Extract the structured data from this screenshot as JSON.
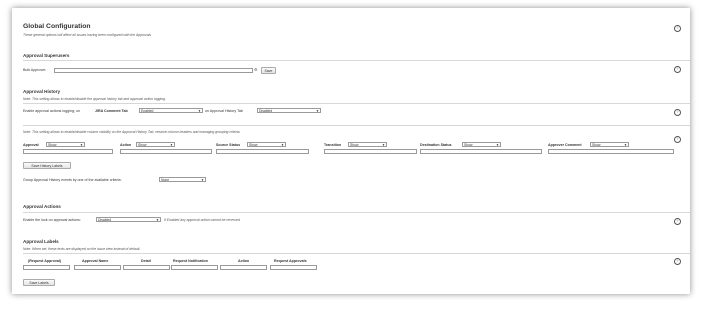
{
  "header": {
    "title": "Global Configuration",
    "subtitle": "These general options will affect all issues having been configured with the Approvals"
  },
  "superusers": {
    "heading": "Approval Superusers",
    "bulk_label": "Bulk Approver:",
    "bulk_value": "",
    "save_label": "Save"
  },
  "history": {
    "heading": "Approval History",
    "note": "Note: This setting allows to enable/disable the approval history tab and approval action logging.",
    "enable_label": "Enable approval actions logging; on",
    "jira_tab_label": "JIRA Comment Tab",
    "jira_tab_value": "Enabled",
    "history_tab_label": "on Approval History Tab",
    "history_tab_value": "Disabled",
    "columns_note": "Note: This setting allows to enable/disable column visibility on the Approval History Tab, rename column headers and managing grouping criteria.",
    "columns": [
      {
        "label": "Approval",
        "value": "Show"
      },
      {
        "label": "Action",
        "value": "Show"
      },
      {
        "label": "Source Status",
        "value": "Show"
      },
      {
        "label": "Transition",
        "value": "Show"
      },
      {
        "label": "Destination Status",
        "value": "Show"
      },
      {
        "label": "Approver Comment",
        "value": "Show"
      }
    ],
    "save_labels": "Save History Labels",
    "group_label": "Group Approval History events by one of the available criteria:",
    "group_value": "None"
  },
  "actions": {
    "heading": "Approval Actions",
    "lock_label": "Enable the lock on approval actions:",
    "lock_value": "Disabled",
    "lock_note": "If Enabled any approval action cannot be reversed."
  },
  "labels": {
    "heading": "Approval Labels",
    "note": "Note: When set, these texts are displayed on the issue view instead of default.",
    "columns": [
      "(Request Approval)",
      "Approval Name",
      "Detail",
      "Request Notification",
      "Action",
      "Request Approvals"
    ],
    "save_label": "Save Labels"
  },
  "icons": {
    "help": "?",
    "dropdown": "▼",
    "settings": "gear-icon"
  }
}
